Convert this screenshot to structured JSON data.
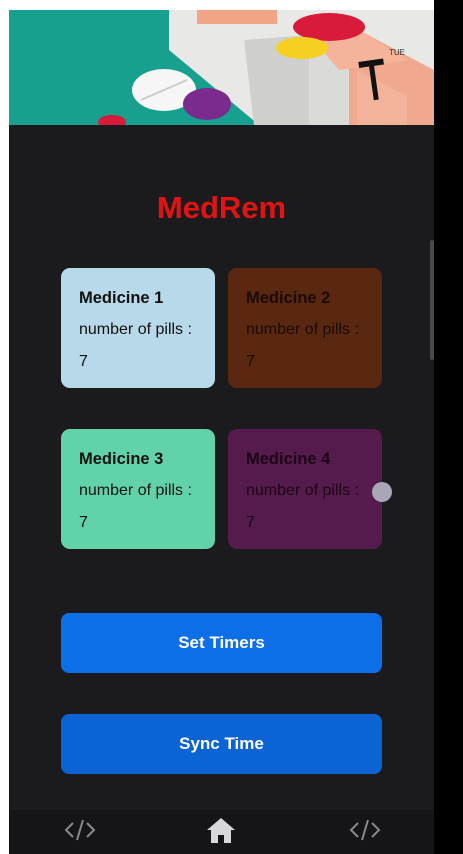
{
  "app": {
    "title": "MedRem"
  },
  "hero": {
    "box_label": "TUE",
    "box_letter": "T"
  },
  "medicines": [
    {
      "name": "Medicine 1",
      "label": "number of pills :",
      "count": "7",
      "color": "#b8d9ea"
    },
    {
      "name": "Medicine 2",
      "label": "number of pills :",
      "count": "7",
      "color": "#5a2710"
    },
    {
      "name": "Medicine 3",
      "label": "number of pills :",
      "count": "7",
      "color": "#62d3a9"
    },
    {
      "name": "Medicine 4",
      "label": "number of pills :",
      "count": "7",
      "color": "#561b4d"
    }
  ],
  "buttons": {
    "set_timers": "Set Timers",
    "sync_time": "Sync Time"
  },
  "nav": {
    "items": [
      {
        "icon": "code-icon"
      },
      {
        "icon": "home-icon"
      },
      {
        "icon": "code-icon"
      }
    ]
  },
  "colors": {
    "title": "#e31313",
    "button": "#0d6fe8",
    "background": "#1b1b1e"
  }
}
